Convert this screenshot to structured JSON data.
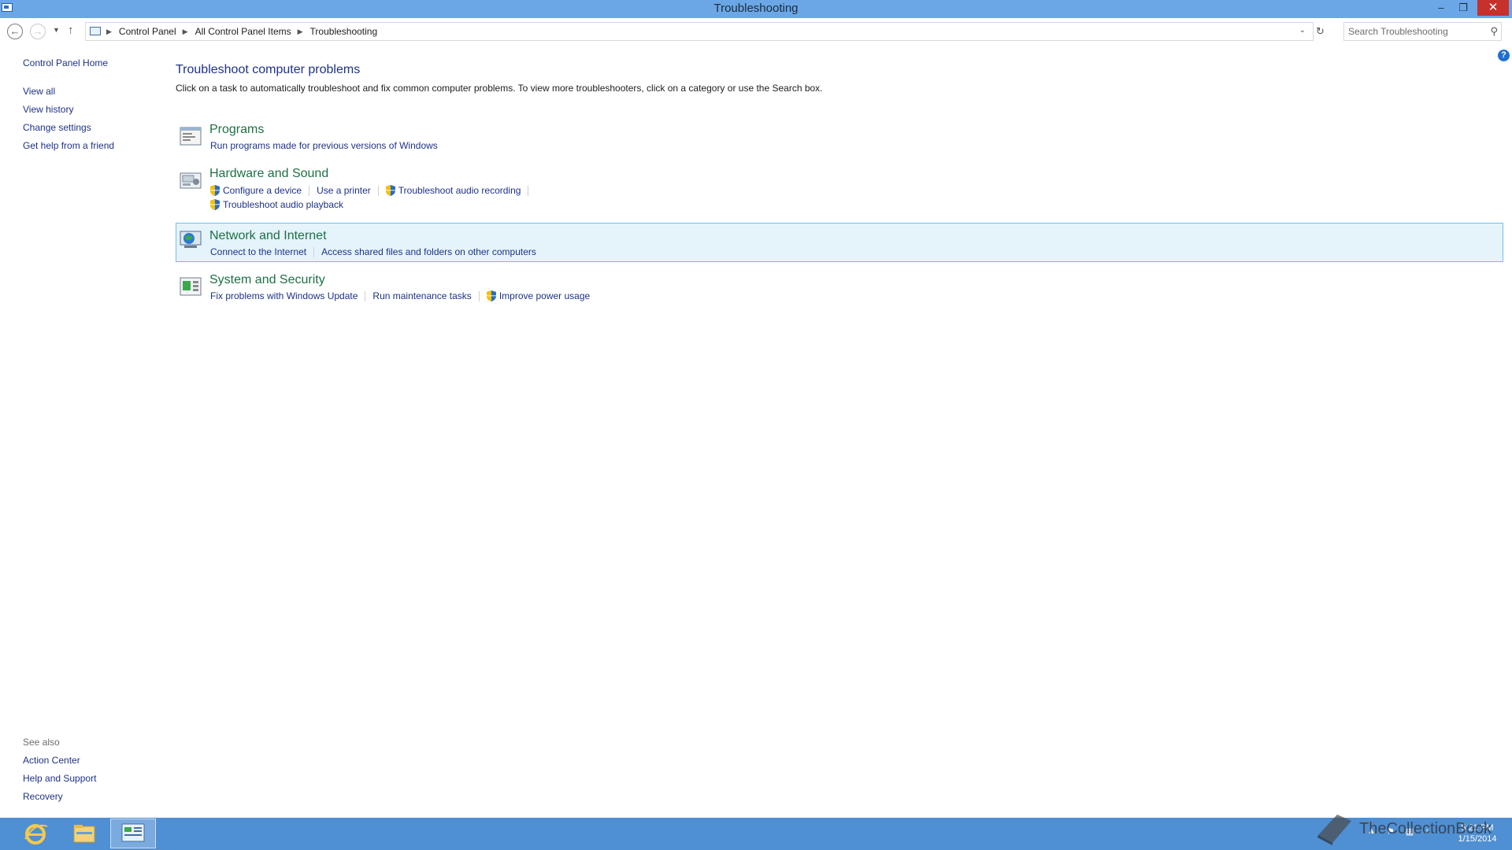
{
  "window": {
    "title": "Troubleshooting",
    "minimize_glyph": "–",
    "maximize_glyph": "❐",
    "close_glyph": "✕"
  },
  "nav": {
    "breadcrumb": [
      "Control Panel",
      "All Control Panel Items",
      "Troubleshooting"
    ],
    "search_placeholder": "Search Troubleshooting"
  },
  "sidebar": {
    "home": "Control Panel Home",
    "links": [
      "View all",
      "View history",
      "Change settings",
      "Get help from a friend"
    ],
    "see_also_header": "See also",
    "see_also": [
      "Action Center",
      "Help and Support",
      "Recovery"
    ]
  },
  "main": {
    "title": "Troubleshoot computer problems",
    "intro": "Click on a task to automatically troubleshoot and fix common computer problems. To view more troubleshooters, click on a category or use the Search box.",
    "categories": [
      {
        "title": "Programs",
        "icon": "programs-icon",
        "rows": [
          [
            {
              "label": "Run programs made for previous versions of Windows",
              "shield": false
            }
          ]
        ]
      },
      {
        "title": "Hardware and Sound",
        "icon": "hardware-sound-icon",
        "rows": [
          [
            {
              "label": "Configure a device",
              "shield": true
            },
            {
              "label": "Use a printer",
              "shield": false
            },
            {
              "label": "Troubleshoot audio recording",
              "shield": true
            }
          ],
          [
            {
              "label": "Troubleshoot audio playback",
              "shield": true
            }
          ]
        ]
      },
      {
        "title": "Network and Internet",
        "icon": "network-icon",
        "highlighted": true,
        "rows": [
          [
            {
              "label": "Connect to the Internet",
              "shield": false
            },
            {
              "label": "Access shared files and folders on other computers",
              "shield": false
            }
          ]
        ]
      },
      {
        "title": "System and Security",
        "icon": "system-security-icon",
        "rows": [
          [
            {
              "label": "Fix problems with Windows Update",
              "shield": false
            },
            {
              "label": "Run maintenance tasks",
              "shield": false
            },
            {
              "label": "Improve power usage",
              "shield": true
            }
          ]
        ]
      }
    ]
  },
  "taskbar": {
    "apps": [
      "internet-explorer-icon",
      "file-explorer-icon",
      "control-panel-icon"
    ],
    "clock_time": "5:21 PM",
    "clock_date": "1/15/2014",
    "watermark": "TheCollectionBook"
  },
  "colors": {
    "titlebar": "#6ba7e6",
    "link": "#1e3287",
    "category_title": "#1e7045",
    "highlight_bg": "#e5f3fb",
    "highlight_border": "#70c0e7",
    "taskbar": "#4f8fd3"
  }
}
